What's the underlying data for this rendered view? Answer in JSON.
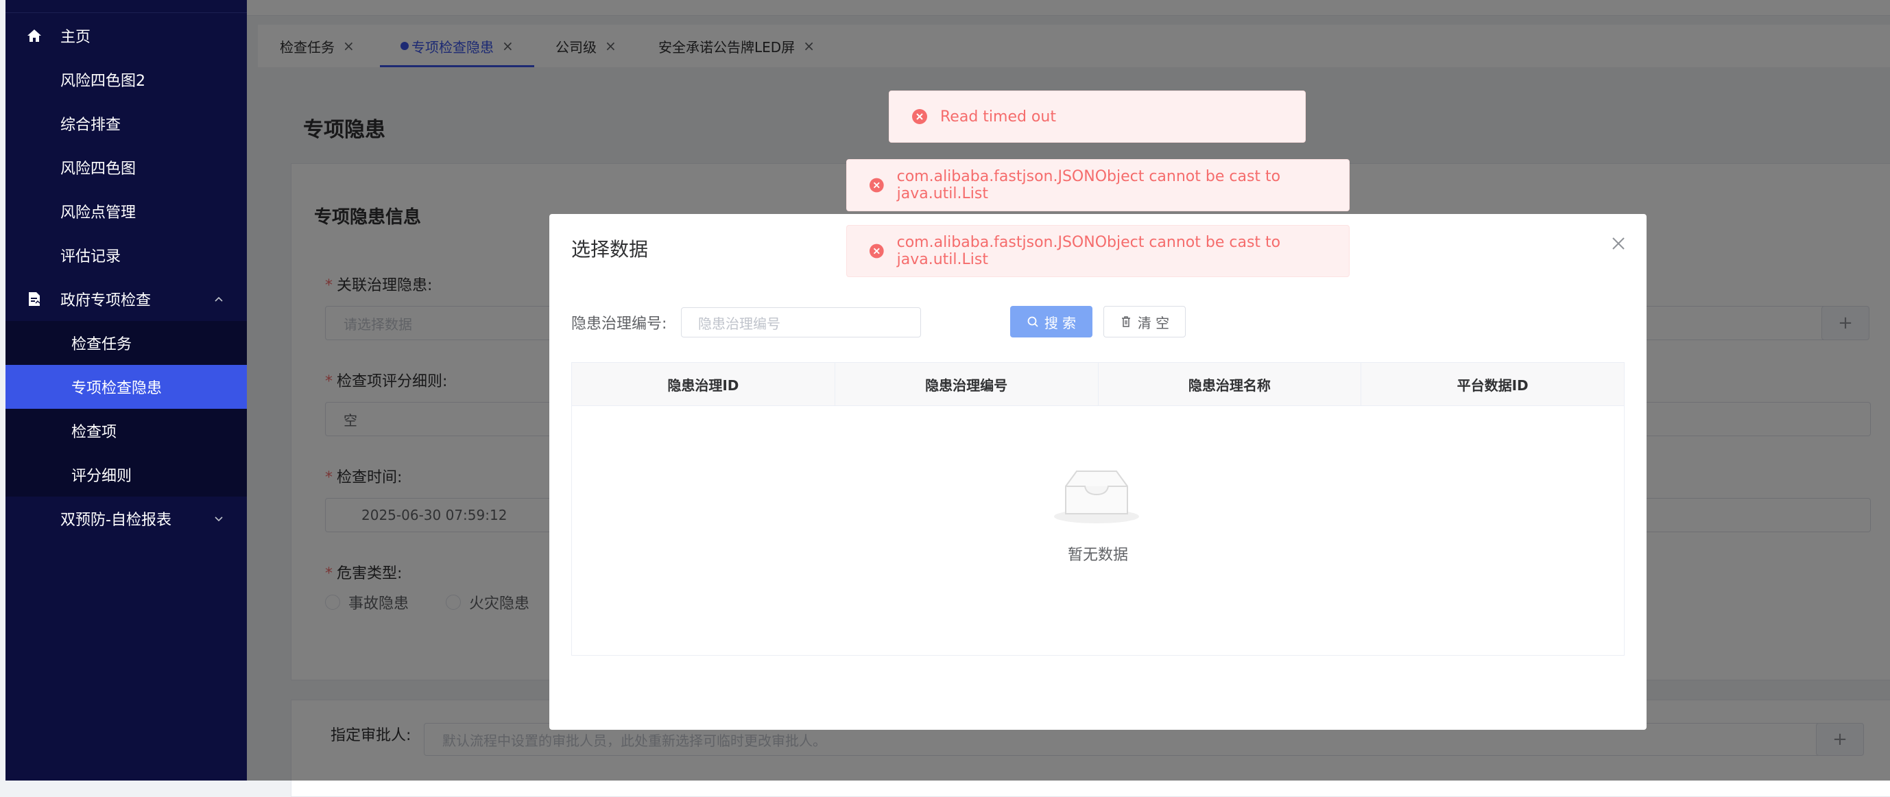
{
  "sidebar": {
    "items": [
      {
        "label": "主页",
        "icon": "home-icon"
      },
      {
        "label": "风险四色图2"
      },
      {
        "label": "综合排查"
      },
      {
        "label": "风险四色图"
      },
      {
        "label": "风险点管理"
      },
      {
        "label": "评估记录"
      },
      {
        "label": "政府专项检查",
        "icon": "document-icon",
        "expanded": true
      },
      {
        "label": "检查任务",
        "sub": true
      },
      {
        "label": "专项检查隐患",
        "sub": true,
        "active": true
      },
      {
        "label": "检查项",
        "sub": true
      },
      {
        "label": "评分细则",
        "sub": true
      },
      {
        "label": "双预防-自检报表",
        "expanded": false
      }
    ]
  },
  "tabs": [
    {
      "label": "检查任务",
      "close": "×"
    },
    {
      "label": "专项检查隐患",
      "close": "×",
      "active": true
    },
    {
      "label": "公司级",
      "close": "×"
    },
    {
      "label": "安全承诺公告牌LED屏",
      "close": "×"
    }
  ],
  "page": {
    "title": "专项隐患",
    "card_title": "专项隐患信息",
    "fields": {
      "related_hazard_label": "关联治理隐患:",
      "related_hazard_placeholder": "请选择数据",
      "score_detail_label": "检查项评分细则:",
      "score_detail_value": "空",
      "check_time_label": "检查时间:",
      "check_time_value": "2025-06-30 07:59:12",
      "hazard_type_label": "危害类型:",
      "hazard_type_options": [
        "事故隐患",
        "火灾隐患"
      ],
      "approver_label": "指定审批人:",
      "approver_placeholder": "默认流程中设置的审批人员，此处重新选择可临时更改审批人。",
      "plus": "+"
    },
    "required_mark": "*"
  },
  "dialog": {
    "title": "选择数据",
    "search_label": "隐患治理编号:",
    "search_placeholder": "隐患治理编号",
    "search_button": "搜 索",
    "clear_button": "清 空",
    "columns": [
      "隐患治理ID",
      "隐患治理编号",
      "隐患治理名称",
      "平台数据ID"
    ],
    "empty_text": "暂无数据"
  },
  "messages": [
    {
      "text": "Read timed out",
      "type": "error"
    },
    {
      "text": "com.alibaba.fastjson.JSONObject cannot be cast to java.util.List",
      "type": "error"
    },
    {
      "text": "com.alibaba.fastjson.JSONObject cannot be cast to java.util.List",
      "type": "error"
    }
  ],
  "colors": {
    "sidebar_bg": "#0c0e3d",
    "accent": "#3a55e6",
    "error": "#f56c6c",
    "error_bg": "#fef0f0",
    "primary_button": "#7da6f5"
  }
}
